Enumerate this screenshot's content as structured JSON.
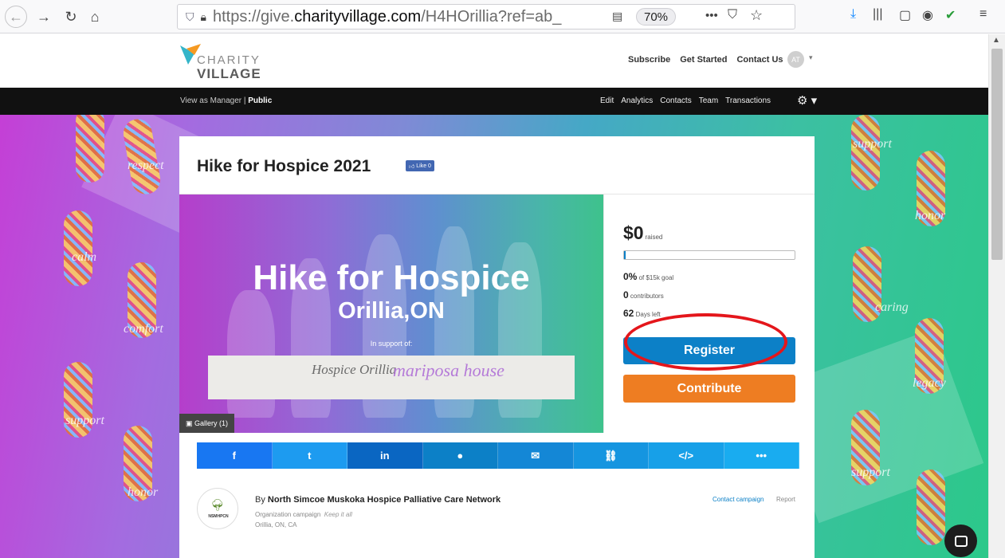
{
  "browser": {
    "url_prefix": "https://give.",
    "url_domain": "charityvillage.com",
    "url_suffix": "/H4HOrillia?ref=ab_",
    "zoom": "70%",
    "icons": [
      "back-icon",
      "forward-icon",
      "reload-icon",
      "home-icon",
      "shield-icon",
      "lock-icon",
      "reader-icon",
      "more-icon",
      "pocket-icon",
      "star-icon",
      "download-icon",
      "library-icon",
      "sidebar-icon",
      "account-icon",
      "check-icon",
      "menu-icon"
    ]
  },
  "site": {
    "logo_charity": "CHARITY",
    "logo_village": "VILLAGE",
    "header_links": [
      "Subscribe",
      "Get Started",
      "Contact Us"
    ],
    "avatar_initials": "AT"
  },
  "manager_bar": {
    "view_as": "View as",
    "manager": "Manager",
    "separator": "|",
    "public": "Public",
    "links": [
      "Edit",
      "Analytics",
      "Contacts",
      "Team",
      "Transactions"
    ]
  },
  "decor_words": [
    "respect",
    "calm",
    "comfort",
    "support",
    "honor",
    "support",
    "honor",
    "caring",
    "legacy",
    "support"
  ],
  "campaign": {
    "title": "Hike for Hospice 2021",
    "like_label": "Like 0",
    "banner_line1": "Hike for Hospice",
    "banner_line2": "Orillia,ON",
    "banner_support": "In support of:",
    "partner1": "Hospice Orillia",
    "partner2": "mariposa house",
    "gallery_label": "Gallery (1)"
  },
  "stats": {
    "raised": "$0",
    "raised_label": "raised",
    "progress_fraction": 0.01,
    "percent": "0%",
    "percent_label": "of $15k goal",
    "contributors": "0",
    "contributors_label": "contributors",
    "days": "62",
    "days_label": "Days left"
  },
  "actions": {
    "register": "Register",
    "contribute": "Contribute"
  },
  "share": [
    {
      "icon": "f",
      "name": "facebook-icon",
      "color": "#1877f2"
    },
    {
      "icon": "t",
      "name": "twitter-icon",
      "color": "#1d9bf0"
    },
    {
      "icon": "in",
      "name": "linkedin-icon",
      "color": "#0a66c2"
    },
    {
      "icon": "●",
      "name": "messenger-icon",
      "color": "#0c80c7"
    },
    {
      "icon": "✉",
      "name": "email-icon",
      "color": "#1487d6"
    },
    {
      "icon": "⛓",
      "name": "link-icon",
      "color": "#1595e0"
    },
    {
      "icon": "</>",
      "name": "embed-icon",
      "color": "#17a0e8"
    },
    {
      "icon": "•••",
      "name": "more-share-icon",
      "color": "#19acf0"
    }
  ],
  "organization": {
    "by": "By",
    "name": "North Simcoe Muskoka Hospice Palliative Care Network",
    "type": "Organization campaign",
    "keep": "Keep it all",
    "location": "Orillia, ON, CA",
    "logo_abbr": "NSMHPCN",
    "contact": "Contact campaign",
    "report": "Report"
  }
}
